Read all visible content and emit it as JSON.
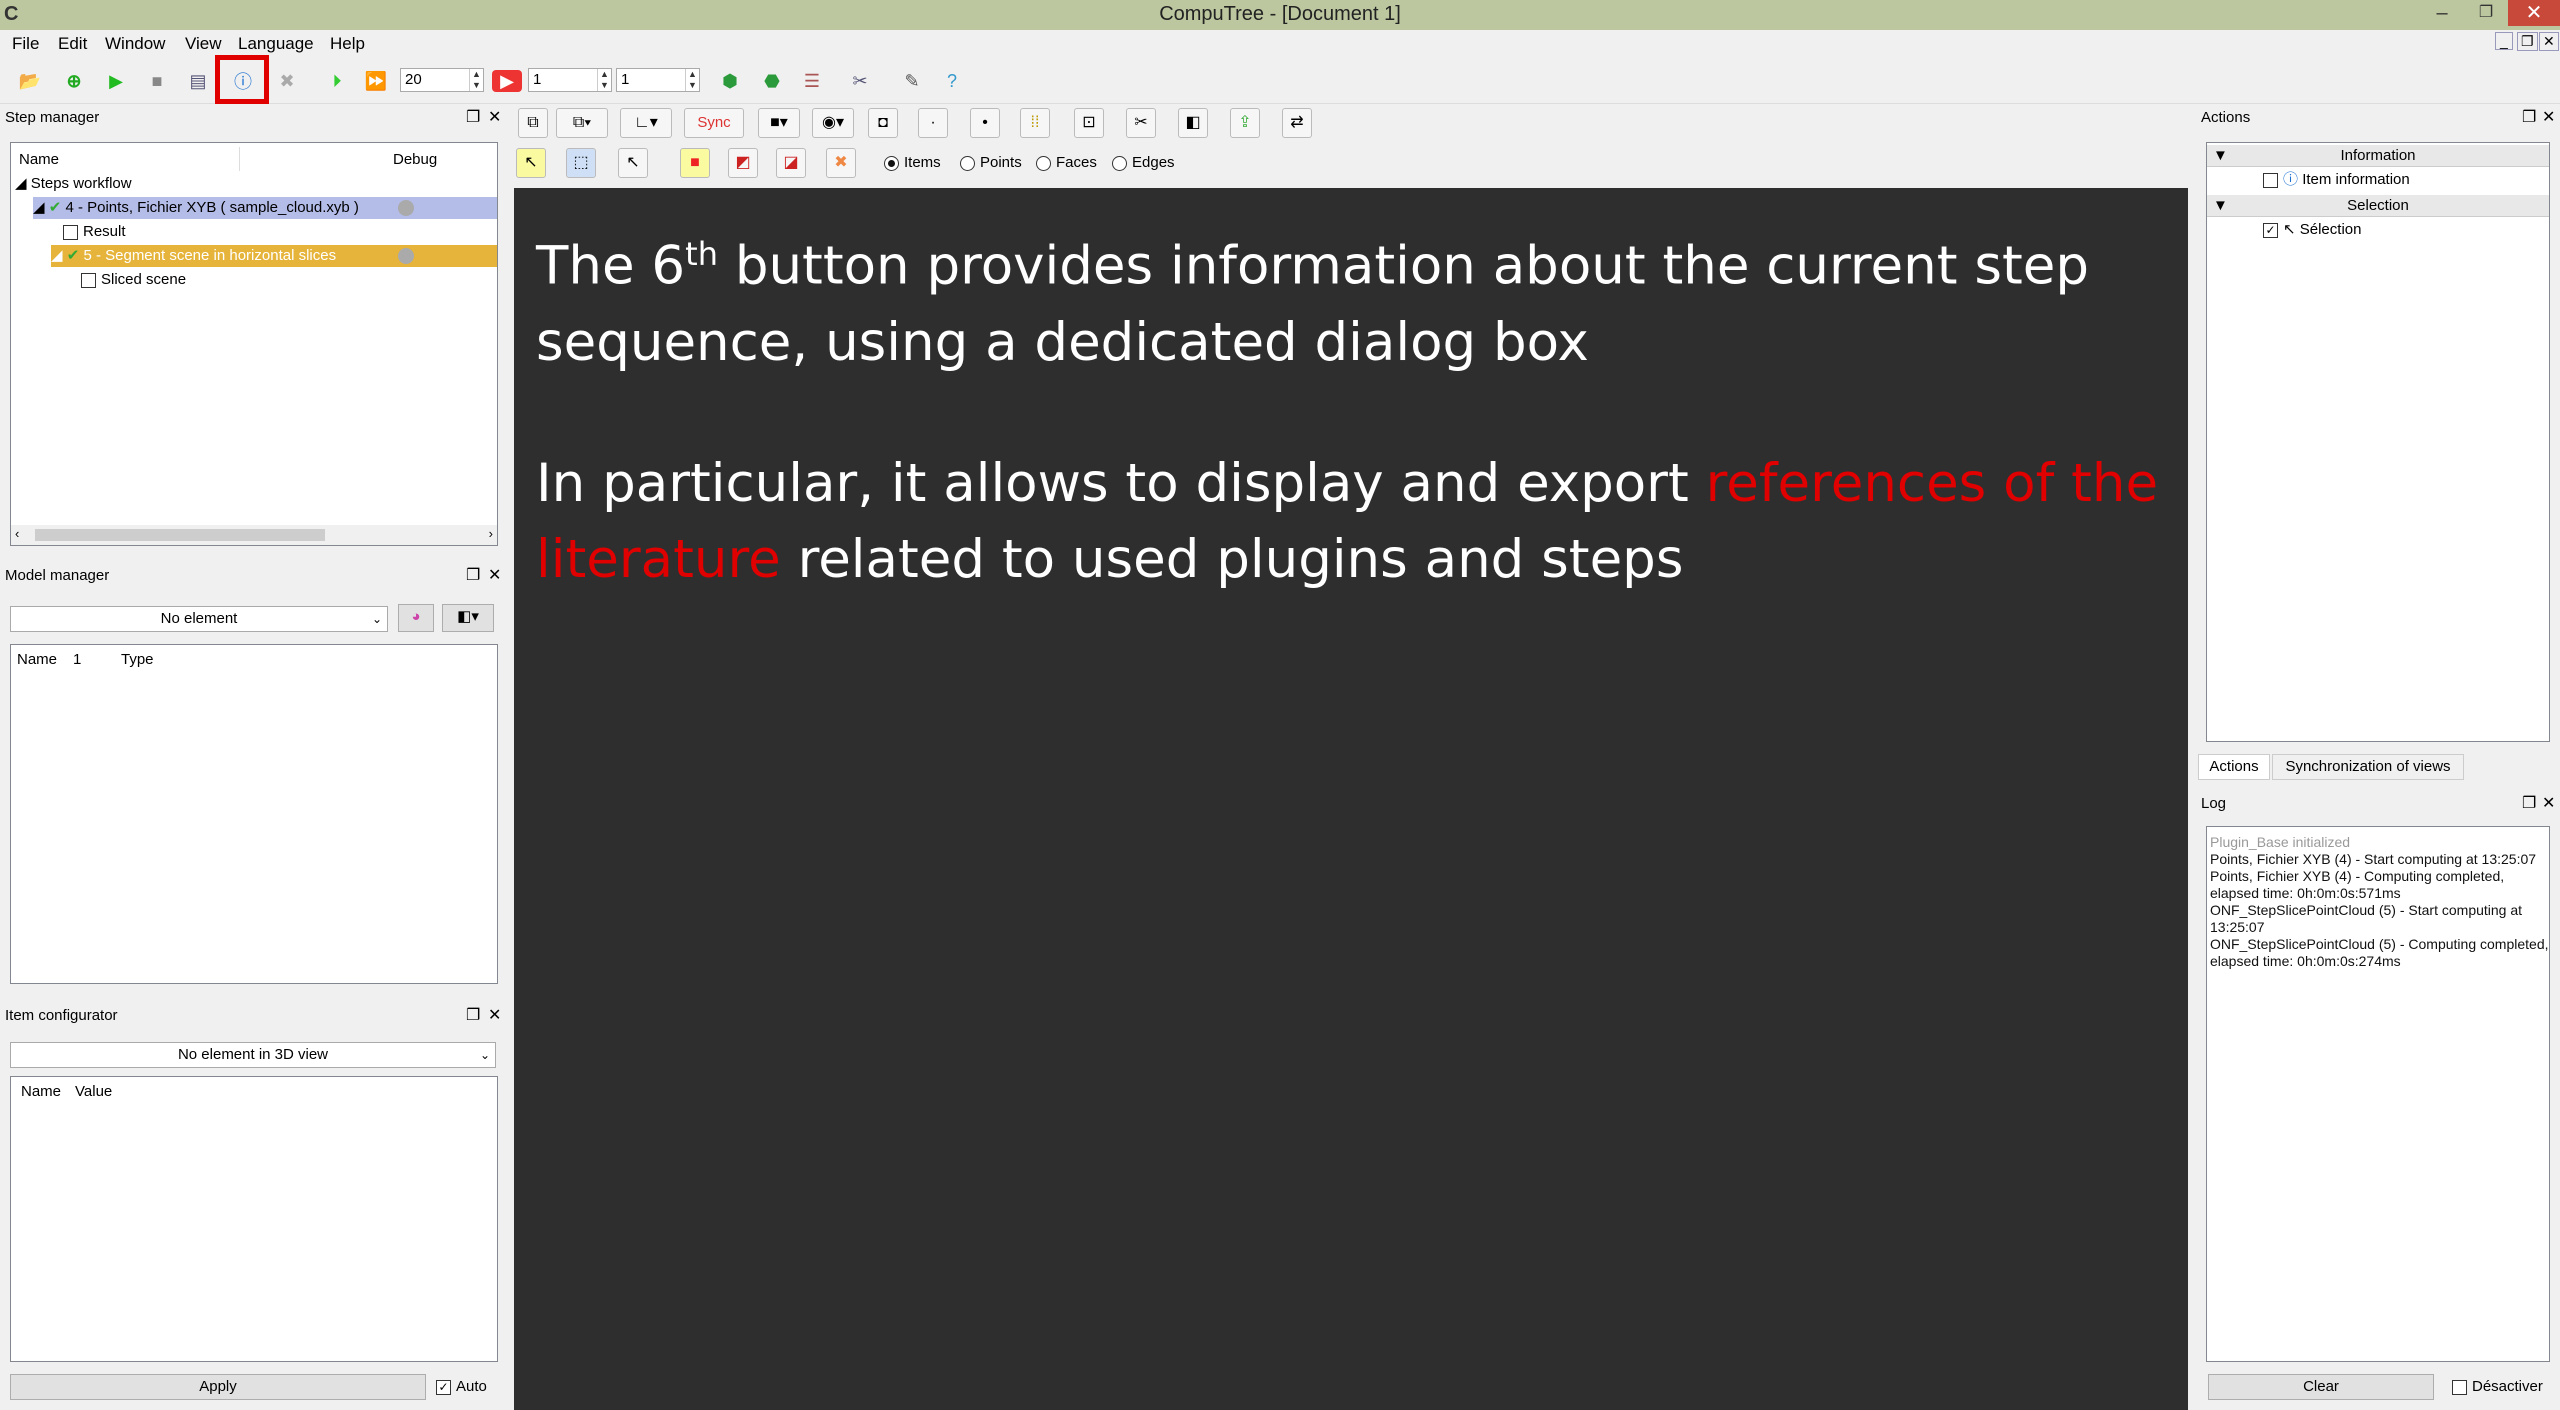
{
  "window": {
    "title": "CompuTree - [Document 1]",
    "logo": "C",
    "minimize": "–",
    "restore": "❐",
    "close": "✕"
  },
  "menu": [
    "File",
    "Edit",
    "Window",
    "View",
    "Language",
    "Help"
  ],
  "toolbar": {
    "delay_value": "20",
    "start_value": "1",
    "end_value": "1"
  },
  "step_manager": {
    "title": "Step manager",
    "columns": [
      "Name",
      "Debug"
    ],
    "root": "Steps workflow",
    "items": [
      {
        "label": "4 - Points, Fichier XYB ( sample_cloud.xyb )"
      },
      {
        "label": "Result"
      },
      {
        "label": "5 - Segment scene in horizontal slices"
      },
      {
        "label": "Sliced scene"
      }
    ]
  },
  "model_manager": {
    "title": "Model manager",
    "combo": "No element",
    "columns": [
      "Name",
      "1",
      "Type"
    ]
  },
  "item_configurator": {
    "title": "Item configurator",
    "combo": "No element in 3D view",
    "columns": [
      "Name",
      "Value"
    ],
    "apply": "Apply",
    "auto": "Auto"
  },
  "view_toolbar": {
    "sync": "Sync",
    "radios": [
      "Items",
      "Points",
      "Faces",
      "Edges"
    ],
    "selected_radio": "Items"
  },
  "slide": {
    "line1_pre": "The 6",
    "line1_sup": "th",
    "line1_post": " button provides information about the current step sequence, using a dedicated dialog box",
    "line2_pre": "In particular, it allows to display and export ",
    "line2_red": "references of the literature",
    "line2_post": " related to used plugins and steps"
  },
  "actions": {
    "title": "Actions",
    "sections": [
      {
        "label": "Information",
        "items": [
          "Item information"
        ]
      },
      {
        "label": "Selection",
        "items": [
          "Sélection"
        ]
      }
    ],
    "tabs": [
      "Actions",
      "Synchronization of views"
    ]
  },
  "log": {
    "title": "Log",
    "first": "Plugin_Base initialized",
    "lines": "Points, Fichier XYB (4) - Start computing at 13:25:07\nPoints, Fichier XYB (4) - Computing completed, elapsed time: 0h:0m:0s:571ms\nONF_StepSlicePointCloud (5) - Start computing at 13:25:07\nONF_StepSlicePointCloud (5) - Computing completed, elapsed time: 0h:0m:0s:274ms",
    "clear": "Clear",
    "deactivate": "Désactiver"
  },
  "colors": {
    "accent_red": "#e00000",
    "titlebar": "#bcc7a0",
    "view_bg": "#2e2e2e",
    "selected_row": "#b4bce8",
    "active_step": "#e6b43a"
  }
}
